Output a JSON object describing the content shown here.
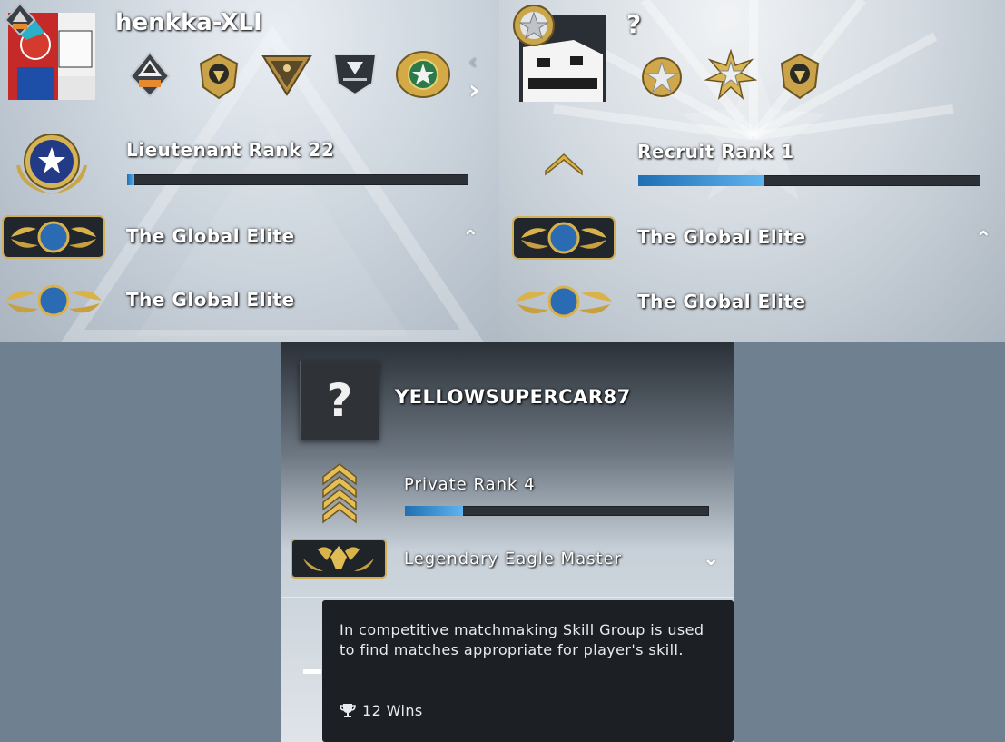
{
  "profiles": [
    {
      "username": "henkka-XLI",
      "rank_label": "Lieutenant Rank 22",
      "xp_progress": 0.02,
      "skill_groups": [
        "The Global Elite",
        "The Global Elite"
      ],
      "show_nav_arrows": true
    },
    {
      "username": "?",
      "rank_label": "Recruit Rank 1",
      "xp_progress": 0.37,
      "skill_groups": [
        "The Global Elite",
        "The Global Elite"
      ]
    },
    {
      "avatar_placeholder": "?",
      "username": "YELLOWSUPERCAR87",
      "rank_label": "Private Rank 4",
      "xp_progress": 0.19,
      "skill_group": "Legendary Eagle Master"
    }
  ],
  "tooltip": {
    "text": "In competitive matchmaking Skill Group is used to find matches appropriate for player's skill.",
    "wins": "12 Wins",
    "icon": "trophy-icon"
  },
  "icons": {
    "prev": "chevron-left-icon",
    "next": "chevron-right-icon",
    "expand_up": "chevron-up-icon",
    "expand_down": "chevron-down-icon"
  },
  "colors": {
    "xp_bar": "#4aa3e0",
    "bar_bg": "#2c3137",
    "tooltip_bg": "#1c1f23",
    "gold": "#d9b24a"
  }
}
